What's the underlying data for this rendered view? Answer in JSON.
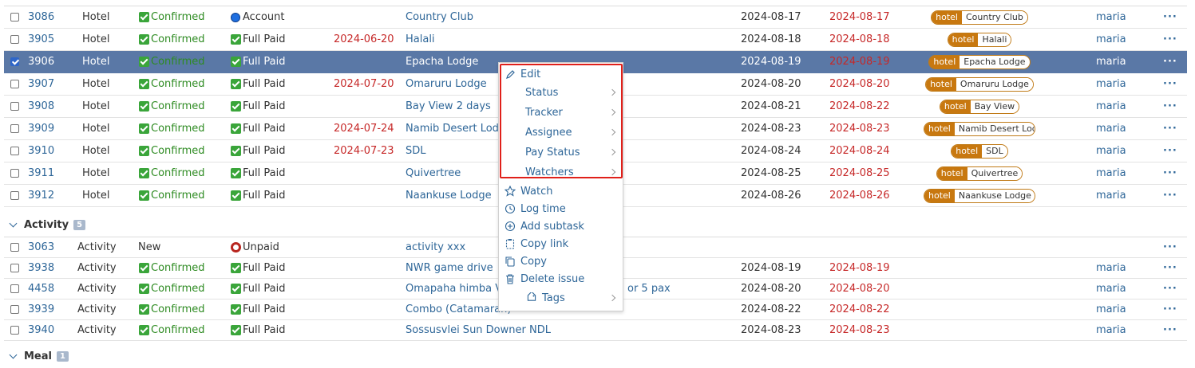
{
  "rows_top": [
    {
      "id": "3086",
      "tracker": "Hotel",
      "status": "Confirmed",
      "pay": "Account",
      "pay_kind": "blue",
      "start": "",
      "subject": "Country Club",
      "start2": "2024-08-17",
      "due": "2024-08-17",
      "tag_key": "hotel",
      "tag_val": "Country Club",
      "assignee": "maria",
      "checked": false
    },
    {
      "id": "3905",
      "tracker": "Hotel",
      "status": "Confirmed",
      "pay": "Full Paid",
      "pay_kind": "green",
      "start": "2024-06-20",
      "subject": "Halali",
      "start2": "2024-08-18",
      "due": "2024-08-18",
      "tag_key": "hotel",
      "tag_val": "Halali",
      "assignee": "maria",
      "checked": false
    },
    {
      "id": "3906",
      "tracker": "Hotel",
      "status": "Confirmed",
      "pay": "Full Paid",
      "pay_kind": "green",
      "start": "",
      "subject": "Epacha Lodge",
      "start2": "2024-08-19",
      "due": "2024-08-19",
      "tag_key": "hotel",
      "tag_val": "Epacha Lodge",
      "assignee": "maria",
      "checked": true
    },
    {
      "id": "3907",
      "tracker": "Hotel",
      "status": "Confirmed",
      "pay": "Full Paid",
      "pay_kind": "green",
      "start": "2024-07-20",
      "subject": "Omaruru Lodge",
      "start2": "2024-08-20",
      "due": "2024-08-20",
      "tag_key": "hotel",
      "tag_val": "Omaruru Lodge",
      "assignee": "maria",
      "checked": false
    },
    {
      "id": "3908",
      "tracker": "Hotel",
      "status": "Confirmed",
      "pay": "Full Paid",
      "pay_kind": "green",
      "start": "",
      "subject": "Bay View 2 days",
      "start2": "2024-08-21",
      "due": "2024-08-22",
      "tag_key": "hotel",
      "tag_val": "Bay View",
      "assignee": "maria",
      "checked": false
    },
    {
      "id": "3909",
      "tracker": "Hotel",
      "status": "Confirmed",
      "pay": "Full Paid",
      "pay_kind": "green",
      "start": "2024-07-24",
      "subject": "Namib Desert Lodg",
      "start2": "2024-08-23",
      "due": "2024-08-23",
      "tag_key": "hotel",
      "tag_val": "Namib Desert Lodge",
      "assignee": "maria",
      "checked": false
    },
    {
      "id": "3910",
      "tracker": "Hotel",
      "status": "Confirmed",
      "pay": "Full Paid",
      "pay_kind": "green",
      "start": "2024-07-23",
      "subject": "SDL",
      "start2": "2024-08-24",
      "due": "2024-08-24",
      "tag_key": "hotel",
      "tag_val": "SDL",
      "assignee": "maria",
      "checked": false
    },
    {
      "id": "3911",
      "tracker": "Hotel",
      "status": "Confirmed",
      "pay": "Full Paid",
      "pay_kind": "green",
      "start": "",
      "subject": "Quivertree",
      "start2": "2024-08-25",
      "due": "2024-08-25",
      "tag_key": "hotel",
      "tag_val": "Quivertree",
      "assignee": "maria",
      "checked": false
    },
    {
      "id": "3912",
      "tracker": "Hotel",
      "status": "Confirmed",
      "pay": "Full Paid",
      "pay_kind": "green",
      "start": "",
      "subject": "Naankuse Lodge",
      "start2": "2024-08-26",
      "due": "2024-08-26",
      "tag_key": "hotel",
      "tag_val": "Naankuse Lodge",
      "assignee": "maria",
      "checked": false
    }
  ],
  "group_activity": {
    "name": "Activity",
    "count": "5"
  },
  "rows_activity": [
    {
      "id": "3063",
      "tracker": "Activity",
      "status": "New",
      "pay": "Unpaid",
      "pay_kind": "red",
      "subject": "activity xxx",
      "start2": "",
      "due": "",
      "assignee": ""
    },
    {
      "id": "3938",
      "tracker": "Activity",
      "status": "Confirmed",
      "pay": "Full Paid",
      "pay_kind": "green",
      "subject": "NWR game drive",
      "start2": "2024-08-19",
      "due": "2024-08-19",
      "assignee": "maria"
    },
    {
      "id": "4458",
      "tracker": "Activity",
      "status": "Confirmed",
      "pay": "Full Paid",
      "pay_kind": "green",
      "subject": "Omapaha himba Vi",
      "subject_tail": "or 5 pax",
      "start2": "2024-08-20",
      "due": "2024-08-20",
      "assignee": "maria"
    },
    {
      "id": "3939",
      "tracker": "Activity",
      "status": "Confirmed",
      "pay": "Full Paid",
      "pay_kind": "green",
      "subject": "Combo (Catamaran)",
      "start2": "2024-08-22",
      "due": "2024-08-22",
      "assignee": "maria"
    },
    {
      "id": "3940",
      "tracker": "Activity",
      "status": "Confirmed",
      "pay": "Full Paid",
      "pay_kind": "green",
      "subject": "Sossusvlei Sun Downer NDL",
      "start2": "2024-08-23",
      "due": "2024-08-23",
      "assignee": "maria"
    }
  ],
  "group_meal": {
    "name": "Meal",
    "count": "1"
  },
  "row_actions": "···",
  "context_menu": {
    "edit": "Edit",
    "status": "Status",
    "tracker": "Tracker",
    "assignee": "Assignee",
    "pay_status": "Pay Status",
    "watchers": "Watchers",
    "watch": "Watch",
    "log_time": "Log time",
    "add_subtask": "Add subtask",
    "copy_link": "Copy link",
    "copy": "Copy",
    "delete_issue": "Delete issue",
    "tags": "Tags"
  }
}
